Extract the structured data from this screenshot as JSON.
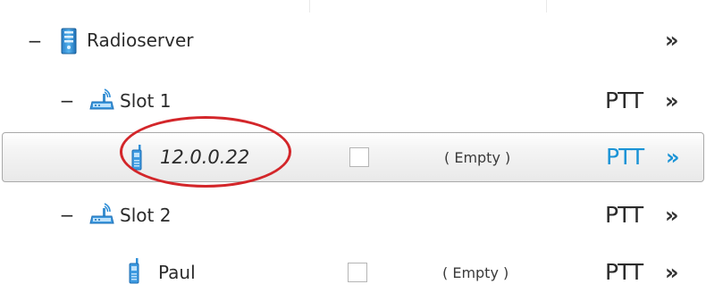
{
  "tree": {
    "rows": [
      {
        "toggle": "−",
        "icon": "server-icon",
        "label": "Radioserver",
        "ptt": "",
        "chevron": "»"
      },
      {
        "toggle": "−",
        "icon": "repeater-slot-icon",
        "label": "Slot 1",
        "ptt": "PTT",
        "chevron": "»"
      },
      {
        "toggle": "",
        "icon": "radio-handset-icon",
        "label": "12.0.0.22",
        "status": "( Empty )",
        "ptt": "PTT",
        "chevron": "»",
        "selected": true
      },
      {
        "toggle": "−",
        "icon": "repeater-slot-icon",
        "label": "Slot 2",
        "ptt": "PTT",
        "chevron": "»"
      },
      {
        "toggle": "",
        "icon": "radio-handset-icon",
        "label": "Paul",
        "status": "( Empty )",
        "ptt": "PTT",
        "chevron": "»"
      }
    ]
  },
  "colors": {
    "accent": "#1a93d6",
    "text": "#2b2b2b",
    "annotation": "#d3262a",
    "selection_border": "#a9a9a9"
  }
}
